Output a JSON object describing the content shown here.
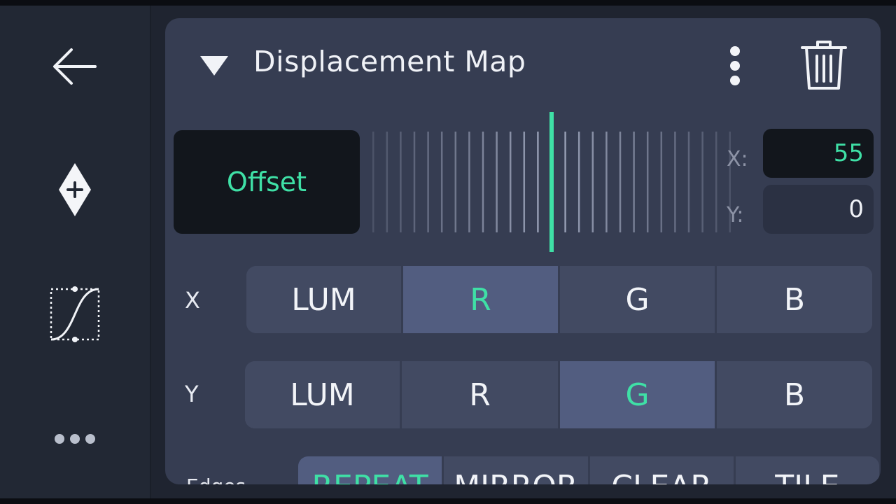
{
  "colors": {
    "accent": "#3fe0a6",
    "panel": "#363d52",
    "sidebar": "#222834",
    "selected": "#525d80"
  },
  "sidebar": {
    "items": [
      {
        "icon": "back-arrow-icon"
      },
      {
        "icon": "add-keyframe-icon"
      },
      {
        "icon": "easing-curve-icon"
      },
      {
        "icon": "more-icon"
      }
    ]
  },
  "effect": {
    "title": "Displacement Map",
    "expanded": true,
    "menu_icon": "kebab-menu-icon",
    "delete_icon": "trash-icon"
  },
  "offset": {
    "button_label": "Offset",
    "x_label": "X:",
    "x_value": "55",
    "y_label": "Y:",
    "y_value": "0"
  },
  "channels": {
    "x": {
      "label": "X",
      "options": [
        "LUM",
        "R",
        "G",
        "B"
      ],
      "selected": "R"
    },
    "y": {
      "label": "Y",
      "options": [
        "LUM",
        "R",
        "G",
        "B"
      ],
      "selected": "G"
    }
  },
  "edges": {
    "label": "Edges",
    "options": [
      "REPEAT",
      "MIRROR",
      "CLEAR",
      "TILE"
    ],
    "selected": "REPEAT"
  }
}
